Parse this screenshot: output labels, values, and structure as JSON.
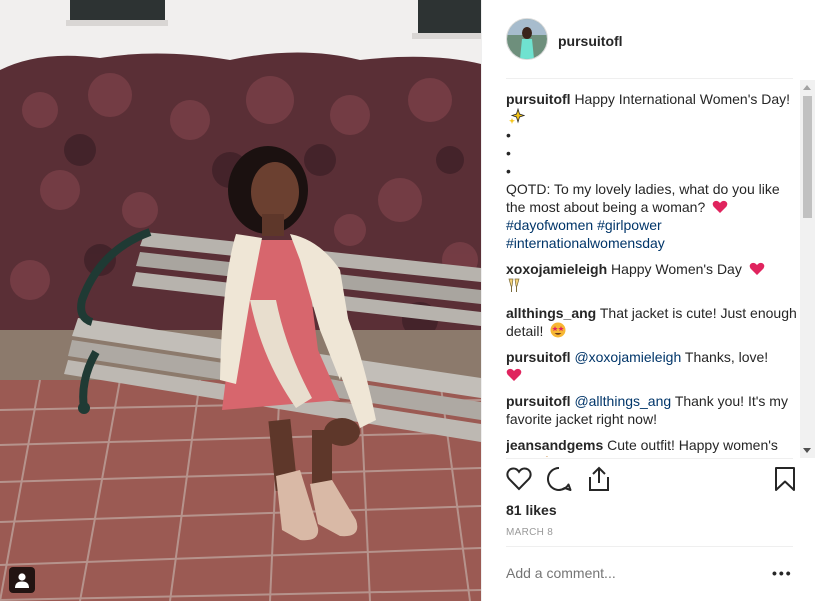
{
  "post": {
    "username": "pursuitofl",
    "caption": {
      "username": "pursuitofl",
      "text": "Happy International Women's Day!",
      "bullets": [
        "•",
        "•",
        "•"
      ],
      "question": "QOTD: To my lovely ladies, what do you like the most about being a woman?",
      "hashtags": [
        "#dayofwomen",
        "#girlpower",
        "#internationalwomensday"
      ]
    },
    "comments": [
      {
        "username": "xoxojamieleigh",
        "text": "Happy Women's Day",
        "emoji": "heart"
      },
      {
        "username": "allthings_ang",
        "text": "That jacket is cute! Just enough detail!",
        "emoji": "star-struck"
      },
      {
        "username": "pursuitofl",
        "mention": "@xoxojamieleigh",
        "text": "Thanks, love!",
        "emoji": "heart"
      },
      {
        "username": "pursuitofl",
        "mention": "@allthings_ang",
        "text": "Thank you! It's my favorite jacket right now!"
      },
      {
        "username": "jeansandgems",
        "text": "Cute outfit! Happy women's day!",
        "emoji": "clap"
      }
    ],
    "likes": "81 likes",
    "date": "MARCH 8",
    "add_comment_placeholder": "Add a comment...",
    "more_label": "•••"
  },
  "icons": [
    "heart-icon",
    "comment-icon",
    "share-icon",
    "bookmark-icon",
    "user-tag-icon"
  ],
  "colors": {
    "hashtag": "#003569",
    "muted": "#999999",
    "text": "#262626",
    "emoji_red": "#e0245e"
  }
}
